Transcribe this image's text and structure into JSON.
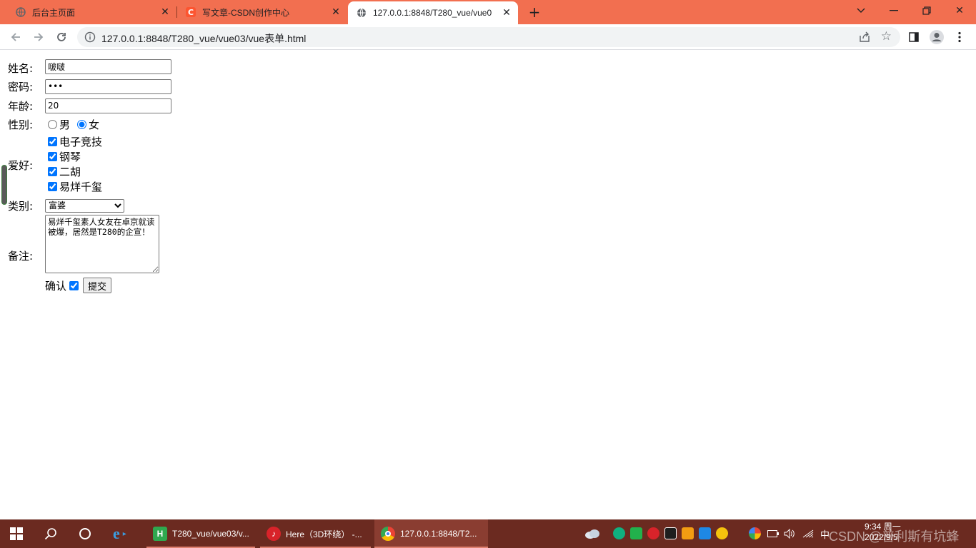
{
  "browser": {
    "tabs": [
      {
        "title": "后台主页面",
        "active": false
      },
      {
        "title": "写文章-CSDN创作中心",
        "active": false
      },
      {
        "title": "127.0.0.1:8848/T280_vue/vue0",
        "active": true
      }
    ],
    "address": "127.0.0.1:8848/T280_vue/vue03/vue表单.html",
    "accent_color": "#f26f50"
  },
  "form": {
    "name_label": "姓名:",
    "name_value": "啵啵",
    "password_label": "密码:",
    "password_value": "123",
    "age_label": "年龄:",
    "age_value": "20",
    "gender_label": "性别:",
    "gender_options": {
      "male": "男",
      "female": "女"
    },
    "gender_selected": "女",
    "hobby_label": "爱好:",
    "hobbies": [
      "电子竞技",
      "钢琴",
      "二胡",
      "易烊千玺"
    ],
    "hobbies_checked": [
      true,
      true,
      true,
      true
    ],
    "category_label": "类别:",
    "category_value": "富婆",
    "remark_label": "备注:",
    "remark_value": "易烊千玺素人女友在卓京就读被爆，居然是T280的企宣！",
    "confirm_label": "确认",
    "confirm_checked": true,
    "submit_label": "提交"
  },
  "taskbar": {
    "apps": [
      {
        "label": "T280_vue/vue03/v...",
        "icon": "hbuilder-icon",
        "color": "#2fa84f"
      },
      {
        "label": "Here（3D环绕）  -...",
        "icon": "netease-music-icon",
        "color": "#d8232a"
      },
      {
        "label": "127.0.0.1:8848/T2...",
        "icon": "chrome-icon",
        "color": "#4285f4"
      }
    ],
    "ime": "中",
    "time": "9:34 周一",
    "date": "2022/9/5",
    "watermark": "CSDN @普利斯有坑蜂"
  }
}
